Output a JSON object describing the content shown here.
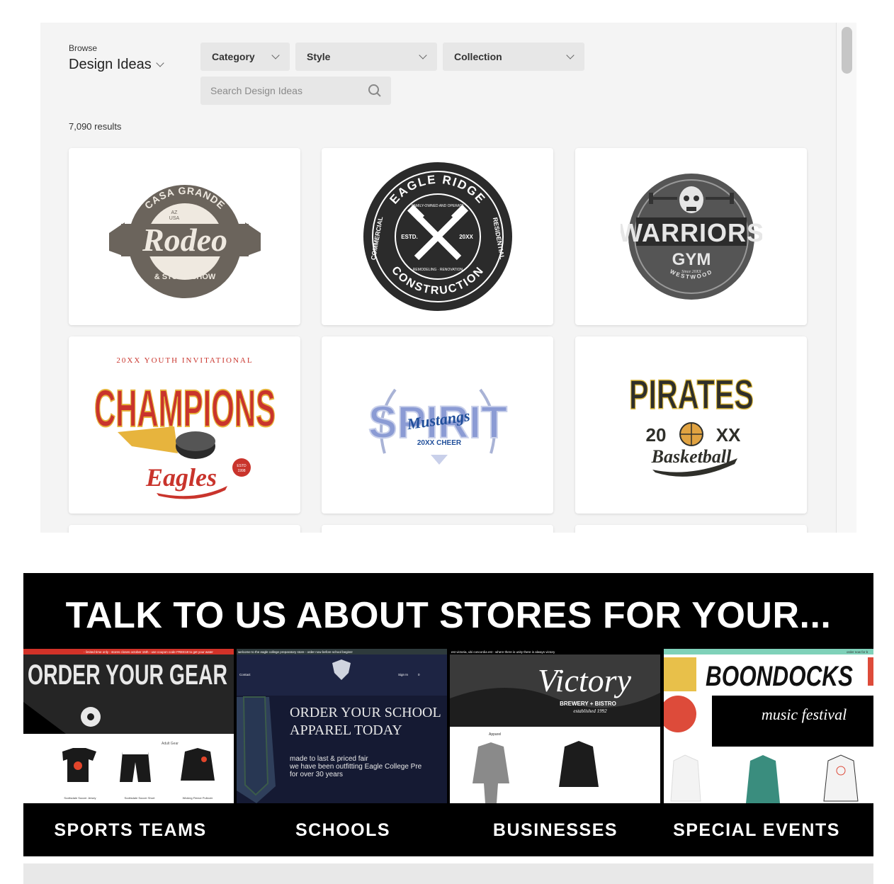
{
  "browse": {
    "label": "Browse",
    "title": "Design Ideas",
    "filters": {
      "category": "Category",
      "style": "Style",
      "collection": "Collection"
    },
    "search_placeholder": "Search Design Ideas",
    "results_text": "7,090 results"
  },
  "designs": [
    {
      "name": "Casa Grande Rodeo",
      "lines": [
        "CASA GRANDE",
        "AZ",
        "USA",
        "Rodeo",
        "& STOCK SHOW"
      ]
    },
    {
      "name": "Eagle Ridge Construction",
      "lines": [
        "EAGLE RIDGE",
        "FAMILY-OWNED AND OPERATE",
        "COMMERCIAL",
        "RESIDENTIAL",
        "ESTD.",
        "20XX",
        "REMODELING · RENOVATION",
        "CONSTRUCTION"
      ]
    },
    {
      "name": "Warriors Gym",
      "lines": [
        "WARRIORS",
        "GYM",
        "Since 20XX",
        "WESTWOOD"
      ]
    },
    {
      "name": "Champions Eagles",
      "lines": [
        "20XX YOUTH INVITATIONAL",
        "CHAMPIONS",
        "Eagles",
        "ESTD",
        "1998"
      ]
    },
    {
      "name": "Spirit Mustangs",
      "lines": [
        "SPIRIT",
        "Mustangs",
        "20XX CHEER"
      ]
    },
    {
      "name": "Pirates Basketball",
      "lines": [
        "PIRATES",
        "20",
        "XX",
        "Basketball"
      ]
    }
  ],
  "stores": {
    "headline": "TALK TO US ABOUT STORES FOR YOUR...",
    "categories": [
      "SPORTS TEAMS",
      "SCHOOLS",
      "BUSINESSES",
      "SPECIAL EVENTS"
    ],
    "screens": {
      "sports": {
        "banner": "- limited time only - stores closes october 15th - use coupon code FREE18 to get your water",
        "hero": "ORDER YOUR GEAR",
        "section": "Adult Gear",
        "products": [
          "Scottsdale Soccer Jersey",
          "Scottsdale Soccer Short",
          "Wicking Fleece Pullover"
        ]
      },
      "school": {
        "banner": "welcome to the eagle college preparatory store - order now before school begins!",
        "nav_contact": "Contact",
        "nav_signin": "Sign In",
        "nav_cart": "0",
        "heading_1": "ORDER YOUR SCHOOL",
        "heading_2": "APPAREL TODAY",
        "body_1": "made to last & priced fair",
        "body_2": "we have been outfitting Eagle College Pre",
        "body_3": "for over 30 years"
      },
      "business": {
        "banner": "est victoria, ubi concordia est - where there is unity there is always victory",
        "brand": "Victory",
        "sub": "BREWERY + BISTRO",
        "est": "established 1992",
        "section": "Apparel"
      },
      "event": {
        "banner": "order now for b",
        "brand": "BOONDOCKS",
        "sub": "music festival"
      }
    }
  },
  "colors": {
    "panel": "#f4f4f4",
    "filter": "#e7e7e7",
    "black": "#000000"
  }
}
